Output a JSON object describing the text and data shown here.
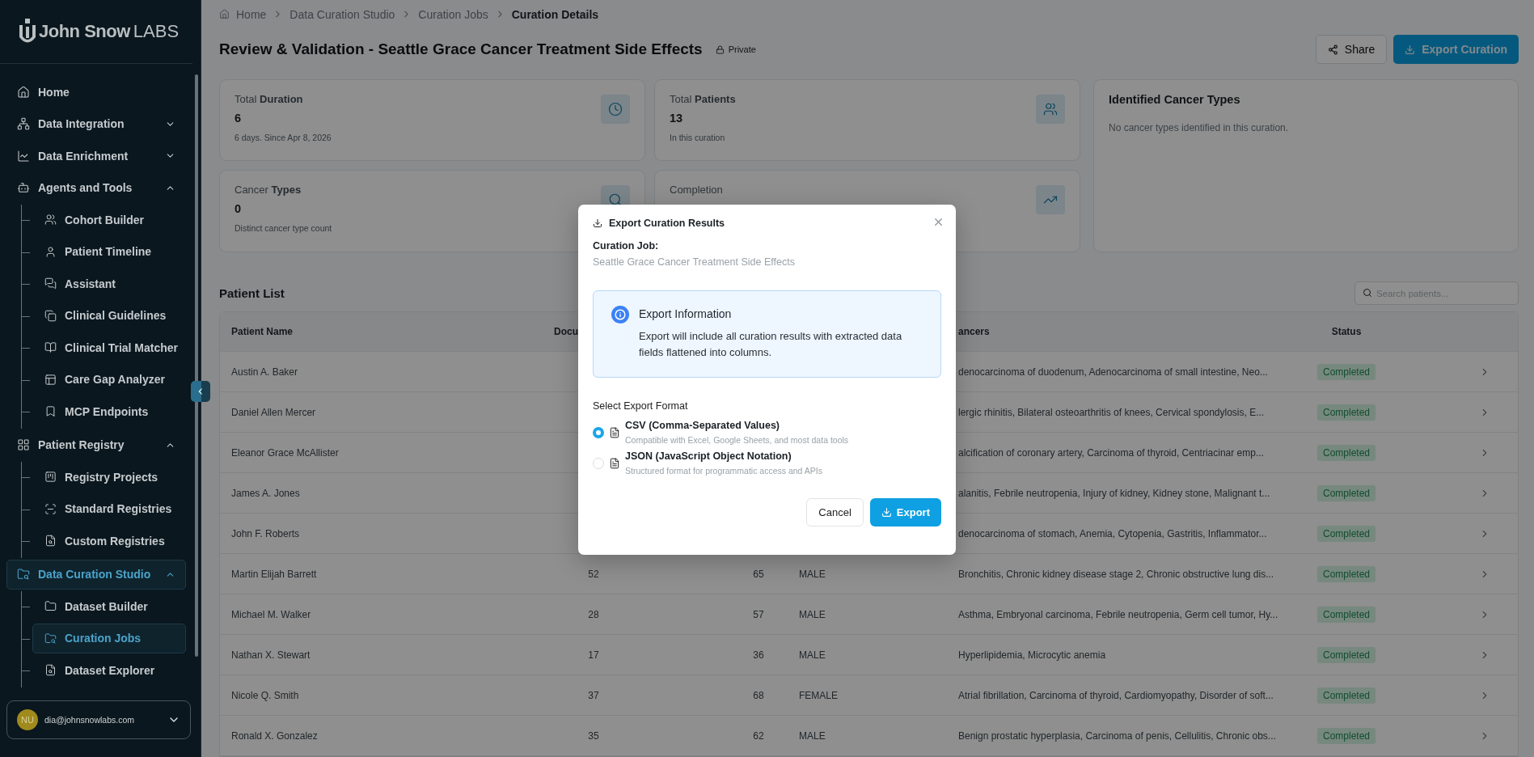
{
  "logo": {
    "name": "John Snow",
    "suffix": "LABS"
  },
  "sidebar": {
    "items": [
      {
        "label": "Home",
        "selected": false
      },
      {
        "label": "Data Integration",
        "selected": false,
        "expanded": false
      },
      {
        "label": "Data Enrichment",
        "selected": false,
        "expanded": false
      },
      {
        "label": "Agents and Tools",
        "selected": false,
        "expanded": true,
        "children": [
          {
            "label": "Cohort Builder",
            "selected": false
          },
          {
            "label": "Patient Timeline",
            "selected": false
          },
          {
            "label": "Assistant",
            "selected": false
          },
          {
            "label": "Clinical Guidelines",
            "selected": false
          },
          {
            "label": "Clinical Trial Matcher",
            "selected": false
          },
          {
            "label": "Care Gap Analyzer",
            "selected": false
          },
          {
            "label": "MCP Endpoints",
            "selected": false
          }
        ]
      },
      {
        "label": "Patient Registry",
        "selected": false,
        "expanded": true,
        "children": [
          {
            "label": "Registry Projects",
            "selected": false
          },
          {
            "label": "Standard Registries",
            "selected": false
          },
          {
            "label": "Custom Registries",
            "selected": false
          }
        ]
      },
      {
        "label": "Data Curation Studio",
        "selected": true,
        "expanded": true,
        "children": [
          {
            "label": "Dataset Builder",
            "selected": false
          },
          {
            "label": "Curation Jobs",
            "selected": true
          },
          {
            "label": "Dataset Explorer",
            "selected": false
          }
        ]
      }
    ],
    "user": {
      "initials": "NU",
      "email": "dia@johnsnowlabs.com"
    }
  },
  "breadcrumb": [
    "Home",
    "Data Curation Studio",
    "Curation Jobs",
    "Curation Details"
  ],
  "title": "Review & Validation - Seattle Grace Cancer Treatment Side Effects",
  "visibility": "Private",
  "actions": {
    "share": "Share",
    "export": "Export Curation"
  },
  "stats": [
    {
      "label": "Total **Duration**",
      "value": "6",
      "sub": "6 days. Since Apr 8, 2026"
    },
    {
      "label": "Total **Patients**",
      "value": "13",
      "sub": "In this curation"
    },
    {
      "label": "Cancer **Types**",
      "value": "0",
      "sub": "Distinct cancer type count"
    },
    {
      "label": "Completion"
    }
  ],
  "cancer_types": {
    "title": "Identified Cancer Types",
    "empty": "No cancer types identified in this curation."
  },
  "patient_list": {
    "title": "Patient List",
    "search": {
      "placeholder": "Search patients..."
    },
    "columns": {
      "name": "Patient Name",
      "column_2": "Docu",
      "column_5": "ancers",
      "status": "Status"
    },
    "rows": [
      {
        "name": "Austin A. Baker",
        "column_5": "denocarcinoma of duodenum, Adenocarcinoma of small intestine, Neo...",
        "status": "Completed"
      },
      {
        "name": "Daniel Allen Mercer",
        "column_5": "lergic rhinitis, Bilateral osteoarthritis of knees, Cervical spondylosis, E...",
        "status": "Completed"
      },
      {
        "name": "Eleanor Grace McAllister",
        "column_5": "alcification of coronary artery, Carcinoma of thyroid, Centriacinar emp...",
        "status": "Completed"
      },
      {
        "name": "James A. Jones",
        "column_5": "alanitis, Febrile neutropenia, Injury of kidney, Kidney stone, Malignant t...",
        "status": "Completed"
      },
      {
        "name": "John F. Roberts",
        "column_5": "denocarcinoma of stomach, Anemia, Cytopenia, Gastritis, Inflammator...",
        "status": "Completed"
      },
      {
        "name": "Martin Elijah Barrett",
        "column_2": "52",
        "column_3": "65",
        "column_4": "MALE",
        "column_5": "Bronchitis, Chronic kidney disease stage 2, Chronic obstructive lung dis...",
        "status": "Completed"
      },
      {
        "name": "Michael M. Walker",
        "column_2": "28",
        "column_3": "57",
        "column_4": "MALE",
        "column_5": "Asthma, Embryonal carcinoma, Febrile neutropenia, Germ cell tumor, Hy...",
        "status": "Completed"
      },
      {
        "name": "Nathan X. Stewart",
        "column_2": "17",
        "column_3": "36",
        "column_4": "MALE",
        "column_5": "Hyperlipidemia, Microcytic anemia",
        "status": "Completed"
      },
      {
        "name": "Nicole Q. Smith",
        "column_2": "37",
        "column_3": "68",
        "column_4": "FEMALE",
        "column_5": "Atrial fibrillation, Carcinoma of thyroid, Cardiomyopathy, Disorder of soft...",
        "status": "Completed"
      },
      {
        "name": "Ronald X. Gonzalez",
        "column_2": "35",
        "column_3": "62",
        "column_4": "MALE",
        "column_5": "Benign prostatic hyperplasia, Carcinoma of penis, Cellulitis, Chronic obs...",
        "status": "Completed"
      }
    ]
  },
  "dialog": {
    "title": "Export Curation Results",
    "job_label": "Curation Job:",
    "job_name": "Seattle Grace Cancer Treatment Side Effects",
    "info": {
      "title": "Export Information",
      "text": "Export will include all curation results with extracted data fields flattened into columns."
    },
    "format_label": "Select Export Format",
    "formats": [
      {
        "title": "CSV (Comma-Separated Values)",
        "desc": "Compatible with Excel, Google Sheets, and most data tools",
        "selected": true
      },
      {
        "title": "JSON (JavaScript Object Notation)",
        "desc": "Structured format for programmatic access and APIs",
        "selected": false
      }
    ],
    "cancel": "Cancel",
    "confirm": "Export"
  }
}
